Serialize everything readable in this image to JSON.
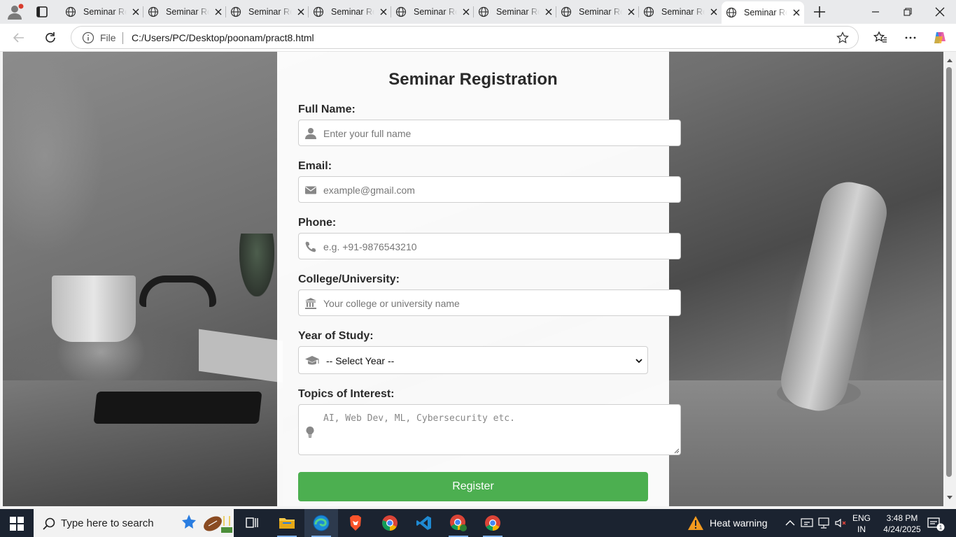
{
  "browser": {
    "tabs": [
      {
        "label": "Seminar Registration",
        "active": false
      },
      {
        "label": "Seminar Registration",
        "active": false
      },
      {
        "label": "Seminar Registration",
        "active": false
      },
      {
        "label": "Seminar Registration",
        "active": false
      },
      {
        "label": "Seminar Registration",
        "active": false
      },
      {
        "label": "Seminar Registration",
        "active": false
      },
      {
        "label": "Seminar Registration",
        "active": false
      },
      {
        "label": "Seminar Registration",
        "active": false
      },
      {
        "label": "Seminar Registration",
        "active": true
      }
    ],
    "address": {
      "scheme_label": "File",
      "url": "C:/Users/PC/Desktop/poonam/pract8.html"
    }
  },
  "form": {
    "title": "Seminar Registration",
    "full_name": {
      "label": "Full Name:",
      "placeholder": "Enter your full name",
      "icon": "user-icon"
    },
    "email": {
      "label": "Email:",
      "placeholder": "example@gmail.com",
      "icon": "envelope-icon"
    },
    "phone": {
      "label": "Phone:",
      "placeholder": "e.g. +91-9876543210",
      "icon": "phone-icon"
    },
    "college": {
      "label": "College/University:",
      "placeholder": "Your college or university name",
      "icon": "university-icon"
    },
    "year": {
      "label": "Year of Study:",
      "selected": "-- Select Year --",
      "icon": "graduation-cap-icon"
    },
    "topics": {
      "label": "Topics of Interest:",
      "placeholder": "AI, Web Dev, ML, Cybersecurity etc.",
      "icon": "lightbulb-icon"
    },
    "submit_label": "Register",
    "button_color": "#4caf50"
  },
  "taskbar": {
    "search_placeholder": "Type here to search",
    "weather_alert": "Heat warning",
    "language": "ENG",
    "region": "IN",
    "time": "3:48 PM",
    "date": "4/24/2025",
    "notification_count": "1"
  }
}
